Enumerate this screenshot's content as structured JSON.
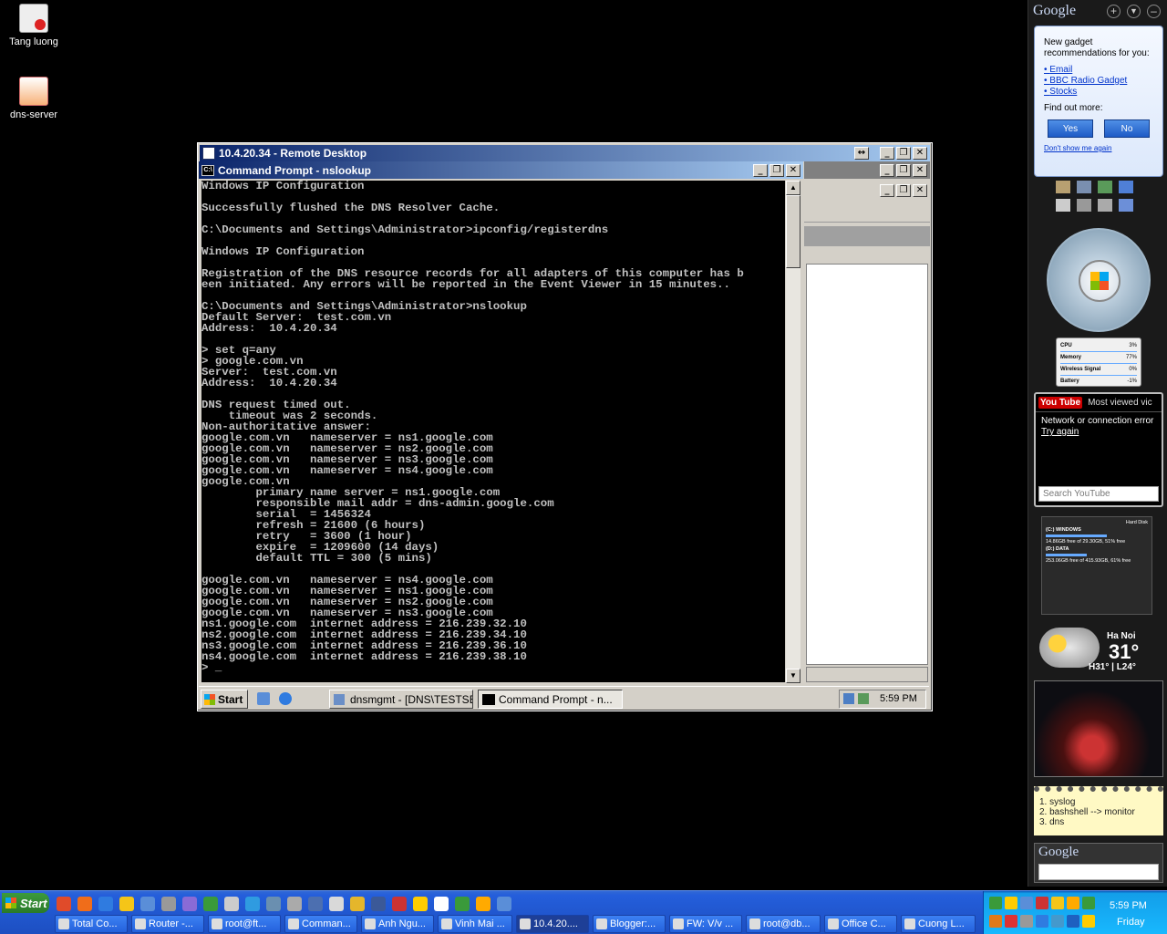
{
  "desktop": {
    "icons": [
      {
        "label": "Tang luong"
      },
      {
        "label": "dns-server"
      }
    ]
  },
  "rdp_window": {
    "title": "10.4.20.34 - Remote Desktop"
  },
  "cmd_window": {
    "title": "Command Prompt - nslookup",
    "console_lines": [
      "Windows IP Configuration",
      "",
      "Successfully flushed the DNS Resolver Cache.",
      "",
      "C:\\Documents and Settings\\Administrator>ipconfig/registerdns",
      "",
      "Windows IP Configuration",
      "",
      "Registration of the DNS resource records for all adapters of this computer has b",
      "een initiated. Any errors will be reported in the Event Viewer in 15 minutes..",
      "",
      "C:\\Documents and Settings\\Administrator>nslookup",
      "Default Server:  test.com.vn",
      "Address:  10.4.20.34",
      "",
      "> set q=any",
      "> google.com.vn",
      "Server:  test.com.vn",
      "Address:  10.4.20.34",
      "",
      "DNS request timed out.",
      "    timeout was 2 seconds.",
      "Non-authoritative answer:",
      "google.com.vn   nameserver = ns1.google.com",
      "google.com.vn   nameserver = ns2.google.com",
      "google.com.vn   nameserver = ns3.google.com",
      "google.com.vn   nameserver = ns4.google.com",
      "google.com.vn",
      "        primary name server = ns1.google.com",
      "        responsible mail addr = dns-admin.google.com",
      "        serial  = 1456324",
      "        refresh = 21600 (6 hours)",
      "        retry   = 3600 (1 hour)",
      "        expire  = 1209600 (14 days)",
      "        default TTL = 300 (5 mins)",
      "",
      "google.com.vn   nameserver = ns4.google.com",
      "google.com.vn   nameserver = ns1.google.com",
      "google.com.vn   nameserver = ns2.google.com",
      "google.com.vn   nameserver = ns3.google.com",
      "ns1.google.com  internet address = 216.239.32.10",
      "ns2.google.com  internet address = 216.239.34.10",
      "ns3.google.com  internet address = 216.239.36.10",
      "ns4.google.com  internet address = 216.239.38.10",
      "> _"
    ]
  },
  "remote_taskbar": {
    "start_label": "Start",
    "tasks": [
      {
        "label": "dnsmgmt - [DNS\\TESTSE..."
      },
      {
        "label": "Command Prompt - n..."
      }
    ],
    "clock": "5:59 PM"
  },
  "sidebar": {
    "google_logo": "Google",
    "gadget_reco": {
      "intro": "New gadget recommendations for you:",
      "links": [
        "Email",
        "BBC Radio Gadget",
        "Stocks"
      ],
      "find_more": "Find out more:",
      "yes": "Yes",
      "no": "No",
      "dont_show": "Don't show me again"
    },
    "meter": {
      "rows": [
        {
          "label": "CPU",
          "value": "3%"
        },
        {
          "label": "Memory",
          "value": "77%"
        },
        {
          "label": "Wireless Signal",
          "value": "0%"
        },
        {
          "label": "Battery",
          "value": "-1%"
        }
      ]
    },
    "youtube": {
      "logo": "You Tube",
      "header": "Most viewed vic",
      "error": "Network or connection error",
      "retry": "Try again",
      "search_placeholder": "Search YouTube"
    },
    "disk": {
      "title": "Hard Disk",
      "drives": [
        {
          "name": "(C:) WINDOWS",
          "info": "14.86GB free of 29.30GB, 51% free"
        },
        {
          "name": "(D:) DATA",
          "info": "253.06GB free of 415.93GB, 61% free"
        }
      ]
    },
    "weather": {
      "city": "Ha Noi",
      "temp": "31°",
      "range": "H31° | L24°"
    },
    "notes": [
      "1. syslog",
      "2. bashshell --> monitor",
      "3. dns"
    ],
    "google_search": {
      "logo": "Google"
    }
  },
  "taskbar": {
    "start_label": "Start",
    "tasks": [
      {
        "label": "Total Co..."
      },
      {
        "label": "Router -..."
      },
      {
        "label": "root@ft..."
      },
      {
        "label": "Comman..."
      },
      {
        "label": "Anh Ngu..."
      },
      {
        "label": "Vinh Mai ..."
      },
      {
        "label": "10.4.20...."
      },
      {
        "label": "Blogger:..."
      },
      {
        "label": "FW: V/v ..."
      },
      {
        "label": "root@db..."
      },
      {
        "label": "Office C..."
      },
      {
        "label": "Cuong L..."
      }
    ],
    "clock": "5:59 PM",
    "day": "Friday"
  }
}
